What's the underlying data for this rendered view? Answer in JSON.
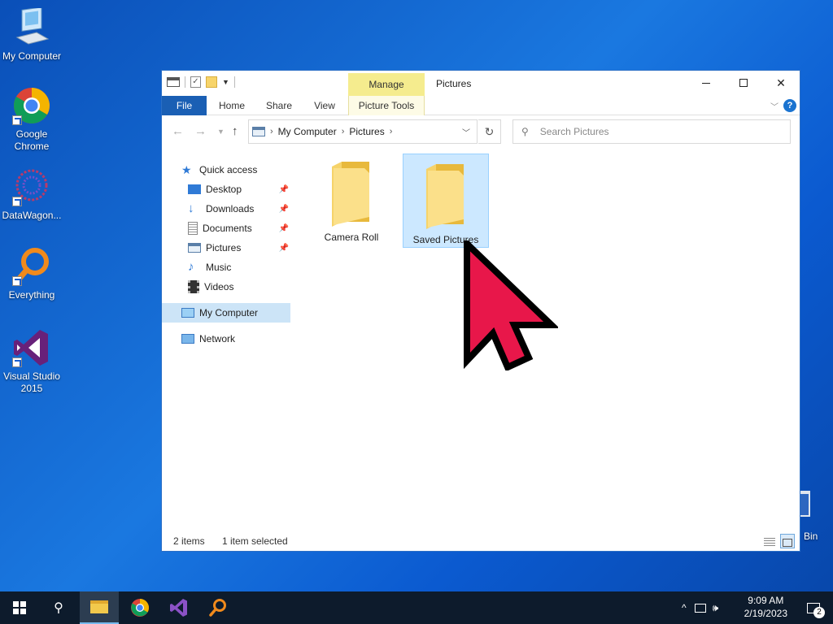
{
  "desktop": {
    "icons": [
      {
        "label": "My Computer"
      },
      {
        "label": "Google Chrome"
      },
      {
        "label": "DataWagon..."
      },
      {
        "label": "Everything"
      },
      {
        "label": "Visual Studio 2015"
      }
    ],
    "recycle_bin_partial": "Bin"
  },
  "window": {
    "title": "Pictures",
    "manage_tab": "Manage",
    "ribbon_tabs": [
      "File",
      "Home",
      "Share",
      "View",
      "Picture Tools"
    ],
    "address": {
      "crumbs": [
        "My Computer",
        "Pictures"
      ]
    },
    "search": {
      "placeholder": "Search Pictures"
    },
    "nav": {
      "quick_access": "Quick access",
      "items": [
        {
          "label": "Desktop",
          "pinned": true
        },
        {
          "label": "Downloads",
          "pinned": true
        },
        {
          "label": "Documents",
          "pinned": true
        },
        {
          "label": "Pictures",
          "pinned": true
        },
        {
          "label": "Music",
          "pinned": false
        },
        {
          "label": "Videos",
          "pinned": false
        }
      ],
      "my_computer": "My Computer",
      "network": "Network"
    },
    "files": [
      {
        "name": "Camera Roll",
        "selected": false
      },
      {
        "name": "Saved Pictures",
        "selected": true
      }
    ],
    "status": {
      "count": "2 items",
      "selection": "1 item selected"
    }
  },
  "taskbar": {
    "time": "9:09 AM",
    "date": "2/19/2023",
    "notification_count": "2"
  },
  "colors": {
    "file_tab": "#1a5fb4",
    "manage_tab": "#f5ec8e",
    "selection": "#cce8ff",
    "cursor": "#e8174a"
  }
}
